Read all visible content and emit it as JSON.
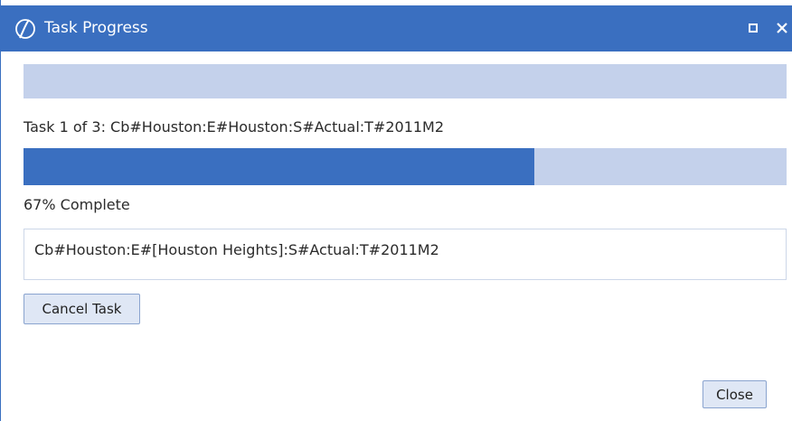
{
  "window": {
    "title": "Task Progress",
    "app_icon": "oneline-logo-icon",
    "controls": {
      "maximize_icon": "maximize-icon",
      "close_icon": "close-icon"
    }
  },
  "colors": {
    "title_bar": "#3a6fc0",
    "progress_fill": "#3a6fc0",
    "progress_track": "#c4d1eb",
    "button_bg": "#dfe7f5",
    "button_border": "#8aa4cf"
  },
  "overall_progress": {
    "value_percent": 0
  },
  "task": {
    "label": "Task 1 of 3: Cb#Houston:E#Houston:S#Actual:T#2011M2",
    "progress_percent": 67,
    "percent_label": "67% Complete"
  },
  "detail": {
    "text": "Cb#Houston:E#[Houston Heights]:S#Actual:T#2011M2"
  },
  "buttons": {
    "cancel_label": "Cancel Task",
    "close_label": "Close"
  }
}
